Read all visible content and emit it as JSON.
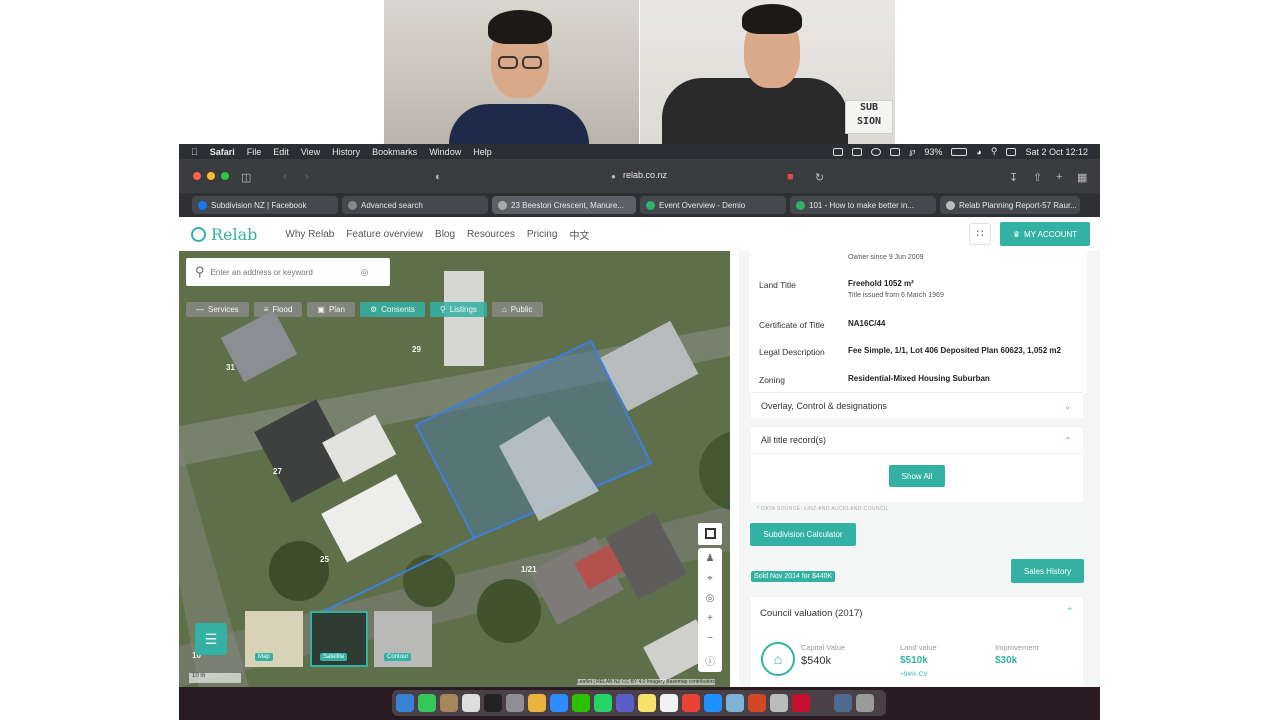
{
  "call": {
    "sign_line1": "SUB",
    "sign_line2": "SION"
  },
  "menubar": {
    "app": "Safari",
    "menus": [
      "File",
      "Edit",
      "View",
      "History",
      "Bookmarks",
      "Window",
      "Help"
    ],
    "battery": "93%",
    "clock": "Sat 2 Oct  12:12"
  },
  "browser": {
    "url": "relab.co.nz",
    "tabs": [
      {
        "title": "Subdivision NZ | Facebook",
        "color": "#1877f2",
        "active": false
      },
      {
        "title": "Advanced search",
        "color": "#888888",
        "active": false
      },
      {
        "title": "23 Beeston Crescent, Manure...",
        "color": "#aaaaaa",
        "active": true
      },
      {
        "title": "Event Overview - Demio",
        "color": "#2fb36b",
        "active": false
      },
      {
        "title": "101 - How to make better in...",
        "color": "#2fb36b",
        "active": false
      },
      {
        "title": "Relab Planning Report-57 Raur...",
        "color": "#bbbbbb",
        "active": false
      }
    ]
  },
  "nav": {
    "logo": "Relab",
    "links": [
      "Why Relab",
      "Feature overview",
      "Blog",
      "Resources",
      "Pricing",
      "中文"
    ],
    "account": "MY ACCOUNT"
  },
  "map": {
    "search_placeholder": "Enter an address or keyword",
    "filters": [
      {
        "label": "Services",
        "active": false
      },
      {
        "label": "Flood",
        "active": false
      },
      {
        "label": "Plan",
        "active": false
      },
      {
        "label": "Consents",
        "active": true
      },
      {
        "label": "Listings",
        "active": true
      },
      {
        "label": "Public",
        "active": false
      }
    ],
    "labels": {
      "l31": "31",
      "l29": "29",
      "l27": "27",
      "l25": "25",
      "l121": "1/21",
      "l10": "10"
    },
    "basemaps": [
      {
        "label": "Map",
        "selected": false
      },
      {
        "label": "Satellite",
        "selected": true
      },
      {
        "label": "Contour",
        "selected": false
      }
    ],
    "scale": "10 m",
    "attribution": "Leaflet | RELAB.NZ CC BY 4.0 Imagery Basemap contributors"
  },
  "panel": {
    "owner_since": "Owner since 9 Jun 2009",
    "land_title_label": "Land Title",
    "land_title_value": "Freehold 1052 m²",
    "land_title_sub": "Title issued from 6 March 1969",
    "cert_label": "Certificate of Title",
    "cert_value": "NA16C/44",
    "legal_label": "Legal Description",
    "legal_value": "Fee Simple, 1/1, Lot 406 Deposited Plan 60623, 1,052 m2",
    "zoning_label": "Zoning",
    "zoning_value": "Residential-Mixed Housing Suburban",
    "overlay": "Overlay, Control & designations",
    "all_titles": "All title record(s)",
    "show_all": "Show All",
    "data_source": "* DATA SOURCE: LINZ AND AUCKLAND COUNCIL",
    "calculator": "Subdivision Calculator",
    "sold_badge": "Sold Nov 2014 for $440K",
    "sales_history": "Sales History",
    "council_valuation": "Council valuation (2017)",
    "capital_label": "Capital Value",
    "capital_value": "$540k",
    "land_label": "Land value",
    "land_value": "$510k",
    "land_pct": "+94% CV",
    "improvement_label": "Improvement",
    "improvement_value": "$30k"
  },
  "colors": {
    "brand": "#33b2a4",
    "menubar": "#2b2e33"
  }
}
